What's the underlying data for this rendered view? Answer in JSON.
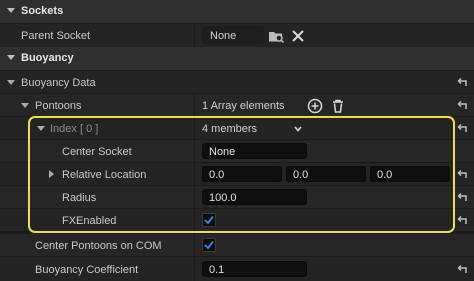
{
  "sockets": {
    "category_label": "Sockets",
    "parent_socket": {
      "label": "Parent Socket",
      "value": "None"
    }
  },
  "buoyancy": {
    "category_label": "Buoyancy",
    "data_label": "Buoyancy Data",
    "pontoons": {
      "label": "Pontoons",
      "summary": "1 Array elements"
    },
    "index": {
      "label": "Index [ 0 ]",
      "summary": "4 members"
    },
    "center_socket": {
      "label": "Center Socket",
      "value": "None"
    },
    "relative_location": {
      "label": "Relative Location",
      "x": "0.0",
      "y": "0.0",
      "z": "0.0"
    },
    "radius": {
      "label": "Radius",
      "value": "100.0"
    },
    "fx_enabled": {
      "label": "FXEnabled",
      "checked": true
    },
    "center_pontoons_on_com": {
      "label": "Center Pontoons on COM",
      "checked": true
    },
    "buoyancy_coefficient": {
      "label": "Buoyancy Coefficient",
      "value": "0.1"
    }
  },
  "colors": {
    "highlight": "#f0e130",
    "accent_check": "#2f8dfb"
  },
  "icons": [
    "chevron-down-icon",
    "browse-asset-icon",
    "clear-x-icon",
    "add-element-icon",
    "delete-icon",
    "reset-to-default-icon",
    "checkmark-icon"
  ]
}
